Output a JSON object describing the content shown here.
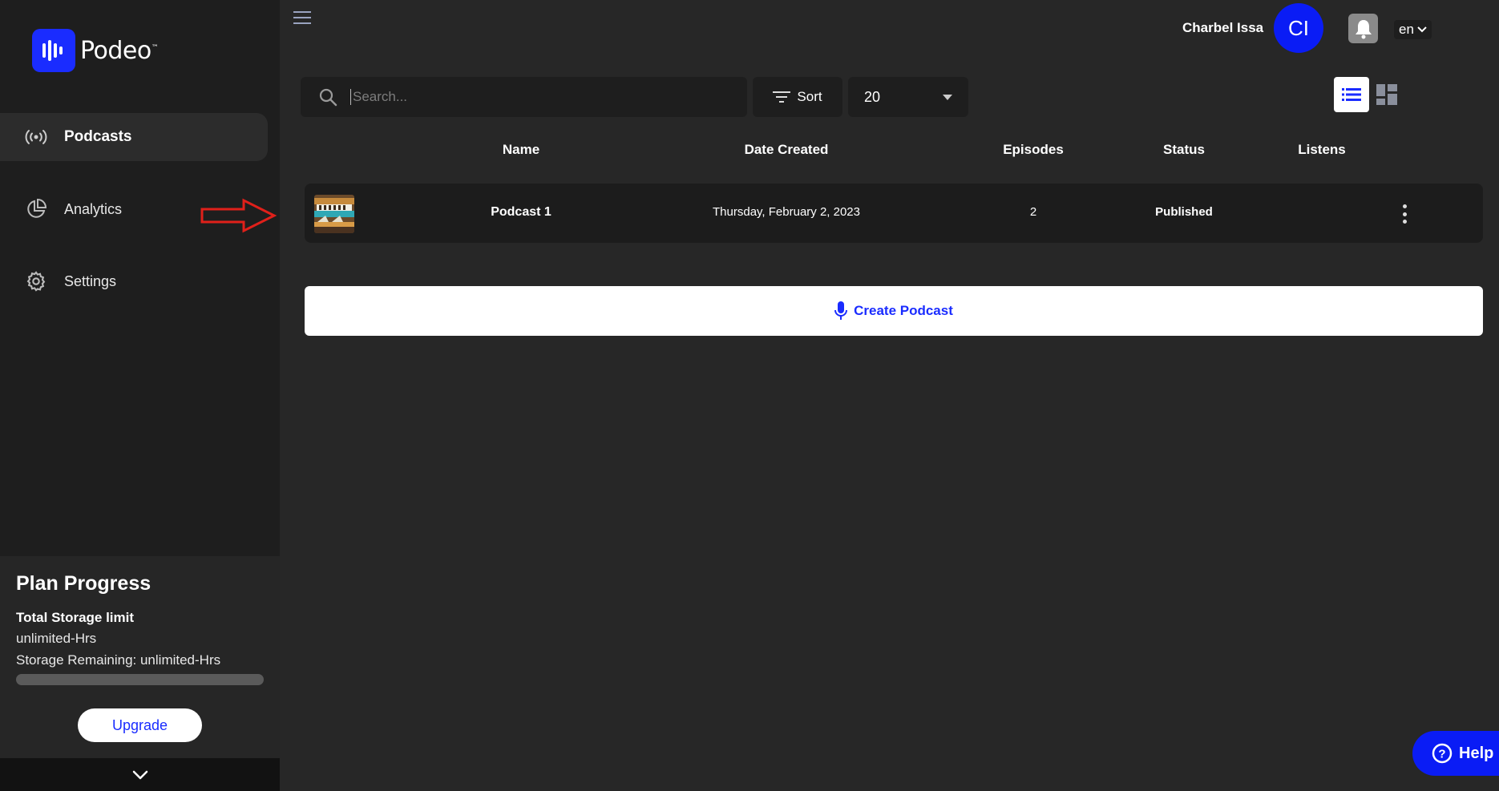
{
  "brand": {
    "name": "Podeo",
    "tm": "™",
    "accent": "#1a2cff"
  },
  "sidebar": {
    "items": [
      {
        "label": "Podcasts",
        "icon": "broadcast-icon",
        "active": true
      },
      {
        "label": "Analytics",
        "icon": "pie-chart-icon",
        "active": false
      },
      {
        "label": "Settings",
        "icon": "gear-icon",
        "active": false
      }
    ]
  },
  "plan": {
    "title": "Plan Progress",
    "storage_label": "Total Storage limit",
    "storage_value": "unlimited-Hrs",
    "remaining": "Storage Remaining: unlimited-Hrs",
    "progress_fraction": 0,
    "upgrade_label": "Upgrade"
  },
  "header": {
    "user_name": "Charbel Issa",
    "avatar_initials": "CI",
    "language": "en"
  },
  "toolbar": {
    "search_placeholder": "Search...",
    "search_value": "",
    "sort_label": "Sort",
    "per_page": "20"
  },
  "table": {
    "columns": [
      "Name",
      "Date Created",
      "Episodes",
      "Status",
      "Listens"
    ],
    "rows": [
      {
        "name": "Podcast 1",
        "date_created": "Thursday, February 2, 2023",
        "episodes": "2",
        "status": "Published",
        "listens": ""
      }
    ]
  },
  "create_label": "Create Podcast",
  "help_label": "Help"
}
